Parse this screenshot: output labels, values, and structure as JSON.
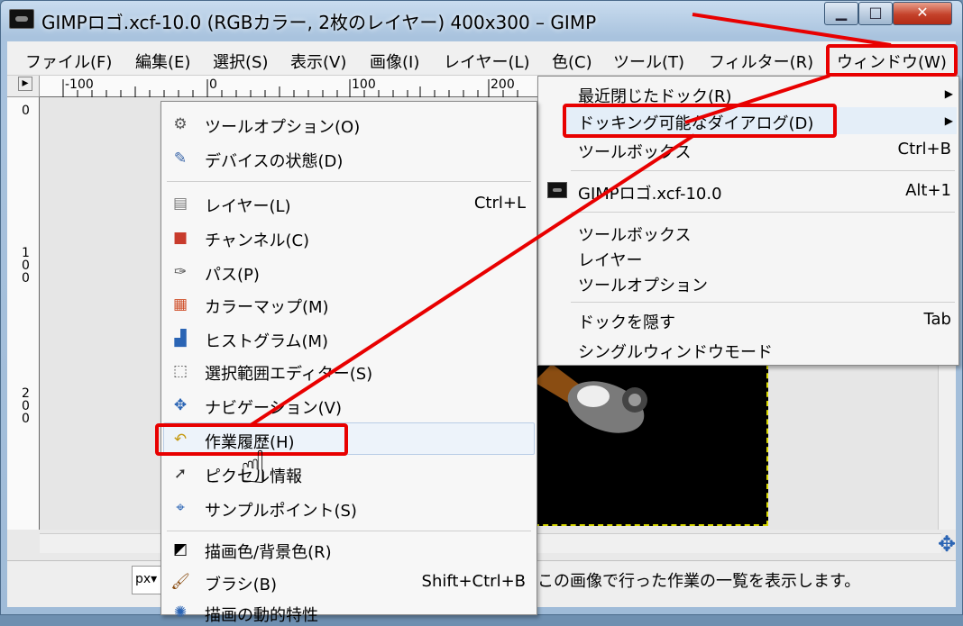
{
  "window": {
    "title": "GIMPロゴ.xcf-10.0 (RGBカラー, 2枚のレイヤー) 400x300 – GIMP",
    "minimize_label": "▁",
    "maximize_label": "□",
    "close_label": "✕"
  },
  "menubar": {
    "items": [
      {
        "label": "ファイル(F)"
      },
      {
        "label": "編集(E)"
      },
      {
        "label": "選択(S)"
      },
      {
        "label": "表示(V)"
      },
      {
        "label": "画像(I)"
      },
      {
        "label": "レイヤー(L)"
      },
      {
        "label": "色(C)"
      },
      {
        "label": "ツール(T)"
      },
      {
        "label": "フィルター(R)"
      },
      {
        "label": "ウィンドウ(W)"
      }
    ]
  },
  "rulers": {
    "h_labels": [
      "-100",
      "0",
      "100",
      "200"
    ],
    "v_labels": [
      "0",
      "100",
      "200"
    ]
  },
  "window_menu": {
    "items": [
      {
        "label": "最近閉じたドック(R)",
        "accel": "",
        "submenu": true
      },
      {
        "label": "ドッキング可能なダイアログ(D)",
        "accel": "",
        "submenu": true
      },
      {
        "label": "ツールボックス",
        "accel": "Ctrl+B"
      },
      {
        "label": "GIMPロゴ.xcf-10.0",
        "accel": "Alt+1"
      },
      {
        "label": "ツールボックス",
        "accel": ""
      },
      {
        "label": "レイヤー",
        "accel": ""
      },
      {
        "label": "ツールオプション",
        "accel": ""
      },
      {
        "label": "ドックを隠す",
        "accel": "Tab"
      },
      {
        "label": "シングルウィンドウモード",
        "accel": ""
      }
    ],
    "submenu_arrow": "▶"
  },
  "dialogs_menu": {
    "items": [
      {
        "label": "ツールオプション(O)",
        "accel": "",
        "icon": "tool-options-icon",
        "glyph": "⚙"
      },
      {
        "label": "デバイスの状態(D)",
        "accel": "",
        "icon": "device-status-icon",
        "glyph": "✎"
      },
      {
        "label": "レイヤー(L)",
        "accel": "Ctrl+L",
        "icon": "layers-icon",
        "glyph": "▤"
      },
      {
        "label": "チャンネル(C)",
        "accel": "",
        "icon": "channels-icon",
        "glyph": "■"
      },
      {
        "label": "パス(P)",
        "accel": "",
        "icon": "paths-icon",
        "glyph": "✑"
      },
      {
        "label": "カラーマップ(M)",
        "accel": "",
        "icon": "colormap-icon",
        "glyph": "▦"
      },
      {
        "label": "ヒストグラム(M)",
        "accel": "",
        "icon": "histogram-icon",
        "glyph": "▟"
      },
      {
        "label": "選択範囲エディター(S)",
        "accel": "",
        "icon": "selection-editor-icon",
        "glyph": "⬚"
      },
      {
        "label": "ナビゲーション(V)",
        "accel": "",
        "icon": "navigation-icon",
        "glyph": "✥"
      },
      {
        "label": "作業履歴(H)",
        "accel": "",
        "icon": "undo-history-icon",
        "glyph": "↶"
      },
      {
        "label": "ピクセル情報",
        "accel": "",
        "icon": "pointer-info-icon",
        "glyph": "➚"
      },
      {
        "label": "サンプルポイント(S)",
        "accel": "",
        "icon": "sample-points-icon",
        "glyph": "⌖"
      },
      {
        "label": "描画色/背景色(R)",
        "accel": "",
        "icon": "fg-bg-colors-icon",
        "glyph": "◩"
      },
      {
        "label": "ブラシ(B)",
        "accel": "Shift+Ctrl+B",
        "icon": "brushes-icon",
        "glyph": "🖌"
      },
      {
        "label": "描画の動的特性",
        "accel": "",
        "icon": "paint-dynamics-icon",
        "glyph": "✺"
      }
    ]
  },
  "statusbar": {
    "unit": "px▾",
    "message": "この画像で行った作業の一覧を表示します。"
  },
  "colors": {
    "annotation_red": "#e80000",
    "menu_highlight": "#e4eef8"
  }
}
